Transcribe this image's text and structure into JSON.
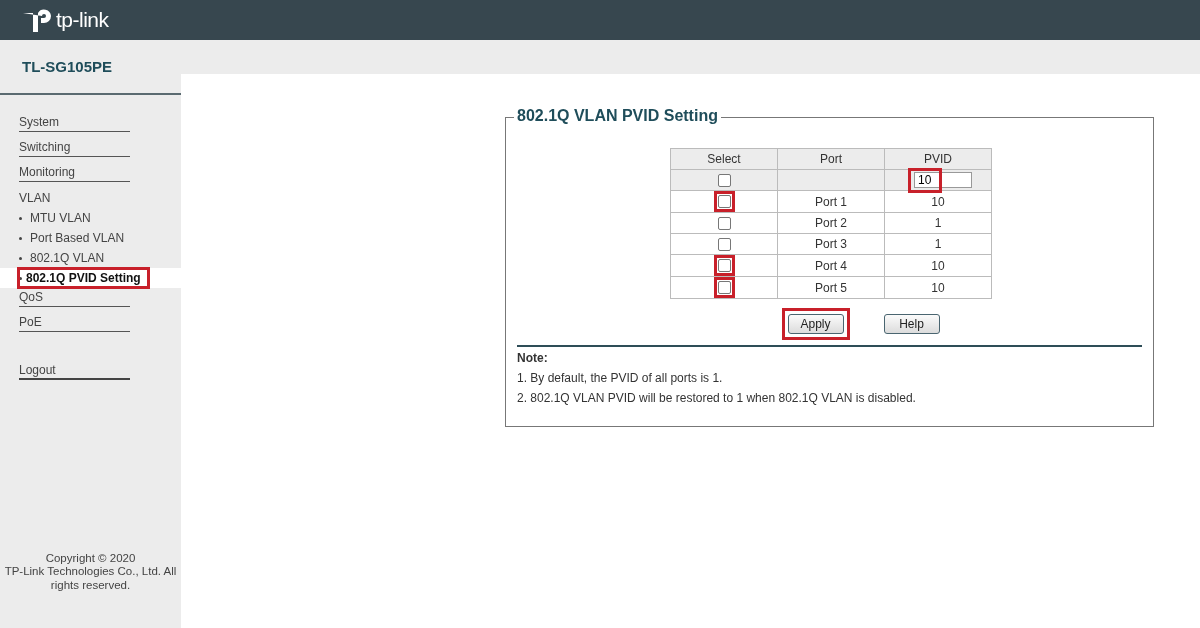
{
  "header": {
    "brand": "tp-link"
  },
  "model": "TL-SG105PE",
  "sidebar": {
    "items": [
      {
        "label": "System",
        "kind": "menu"
      },
      {
        "label": "Switching",
        "kind": "menu"
      },
      {
        "label": "Monitoring",
        "kind": "menu"
      },
      {
        "label": "VLAN",
        "kind": "group",
        "children": [
          {
            "label": "MTU VLAN",
            "selected": false,
            "highlighted": false
          },
          {
            "label": "Port Based VLAN",
            "selected": false,
            "highlighted": false
          },
          {
            "label": "802.1Q VLAN",
            "selected": false,
            "highlighted": false
          },
          {
            "label": "802.1Q PVID Setting",
            "selected": true,
            "highlighted": true
          }
        ]
      },
      {
        "label": "QoS",
        "kind": "menu"
      },
      {
        "label": "PoE",
        "kind": "menu"
      },
      {
        "label": "Logout",
        "kind": "logout"
      }
    ],
    "copyright_lines": [
      "Copyright © 2020",
      "TP-Link Technologies Co., Ltd. All",
      "rights reserved."
    ]
  },
  "panel": {
    "title": "802.1Q VLAN PVID Setting",
    "columns": [
      "Select",
      "Port",
      "PVID"
    ],
    "all_row": {
      "checked": false,
      "highlighted": false,
      "pvid_value": "10",
      "pvid_highlighted": true
    },
    "rows": [
      {
        "checked": false,
        "highlighted": true,
        "port": "Port 1",
        "pvid": "10"
      },
      {
        "checked": false,
        "highlighted": false,
        "port": "Port 2",
        "pvid": "1"
      },
      {
        "checked": false,
        "highlighted": false,
        "port": "Port 3",
        "pvid": "1"
      },
      {
        "checked": false,
        "highlighted": true,
        "port": "Port 4",
        "pvid": "10"
      },
      {
        "checked": false,
        "highlighted": true,
        "port": "Port 5",
        "pvid": "10"
      }
    ],
    "buttons": [
      {
        "label": "Apply",
        "highlighted": true
      },
      {
        "label": "Help",
        "highlighted": false
      }
    ],
    "note": {
      "title": "Note:",
      "lines": [
        "1. By default, the PVID of all ports is 1.",
        "2. 802.1Q VLAN PVID will be restored to 1 when 802.1Q VLAN is disabled."
      ]
    }
  }
}
